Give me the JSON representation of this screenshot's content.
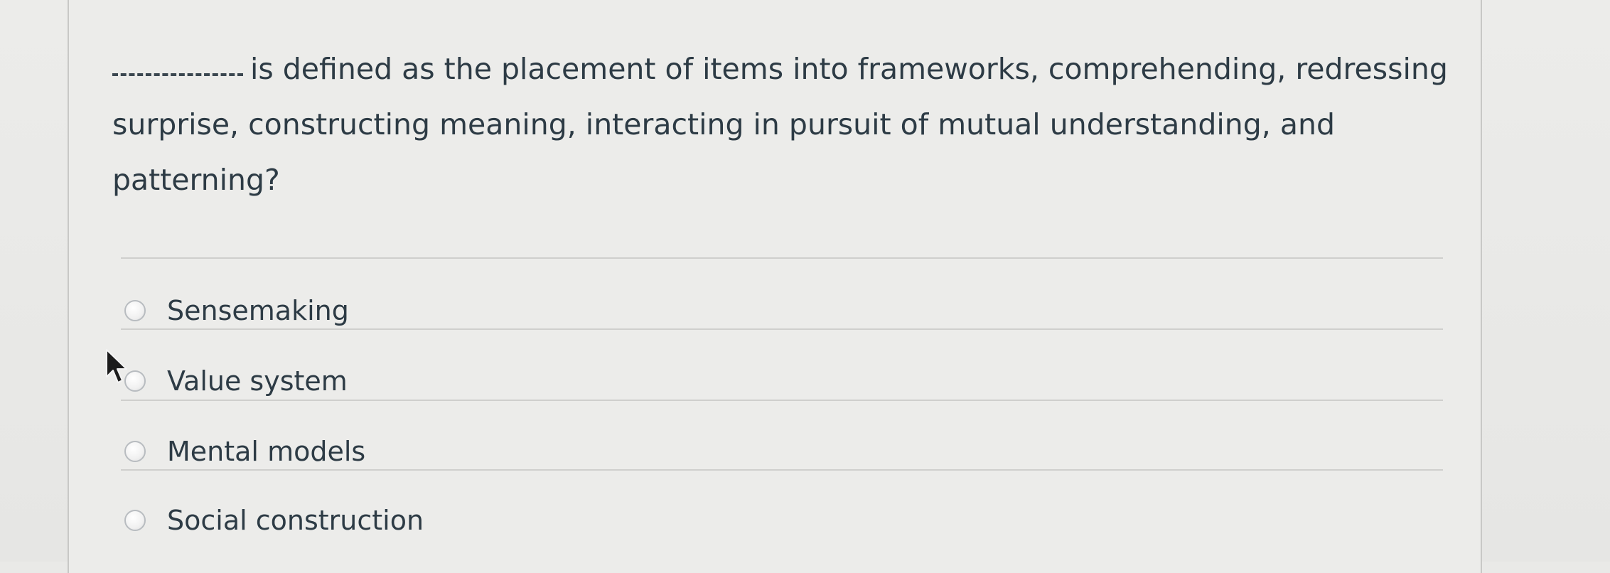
{
  "question": {
    "blank": "_________",
    "line1": "is defined as the placement of items into frameworks, comprehending, redressing",
    "line2": "surprise, constructing meaning, interacting in pursuit of mutual understanding, and",
    "line3": "patterning?"
  },
  "answers": [
    {
      "label": "Sensemaking",
      "selected": false
    },
    {
      "label": "Value system",
      "selected": false
    },
    {
      "label": "Mental models",
      "selected": false
    },
    {
      "label": "Social construction",
      "selected": false
    }
  ],
  "icons": {
    "cursor": "arrow-cursor-icon",
    "radio": "radio-button-icon"
  },
  "colors": {
    "text": "#2d3b45",
    "background": "#ececea",
    "divider": "#cfcfcd"
  }
}
